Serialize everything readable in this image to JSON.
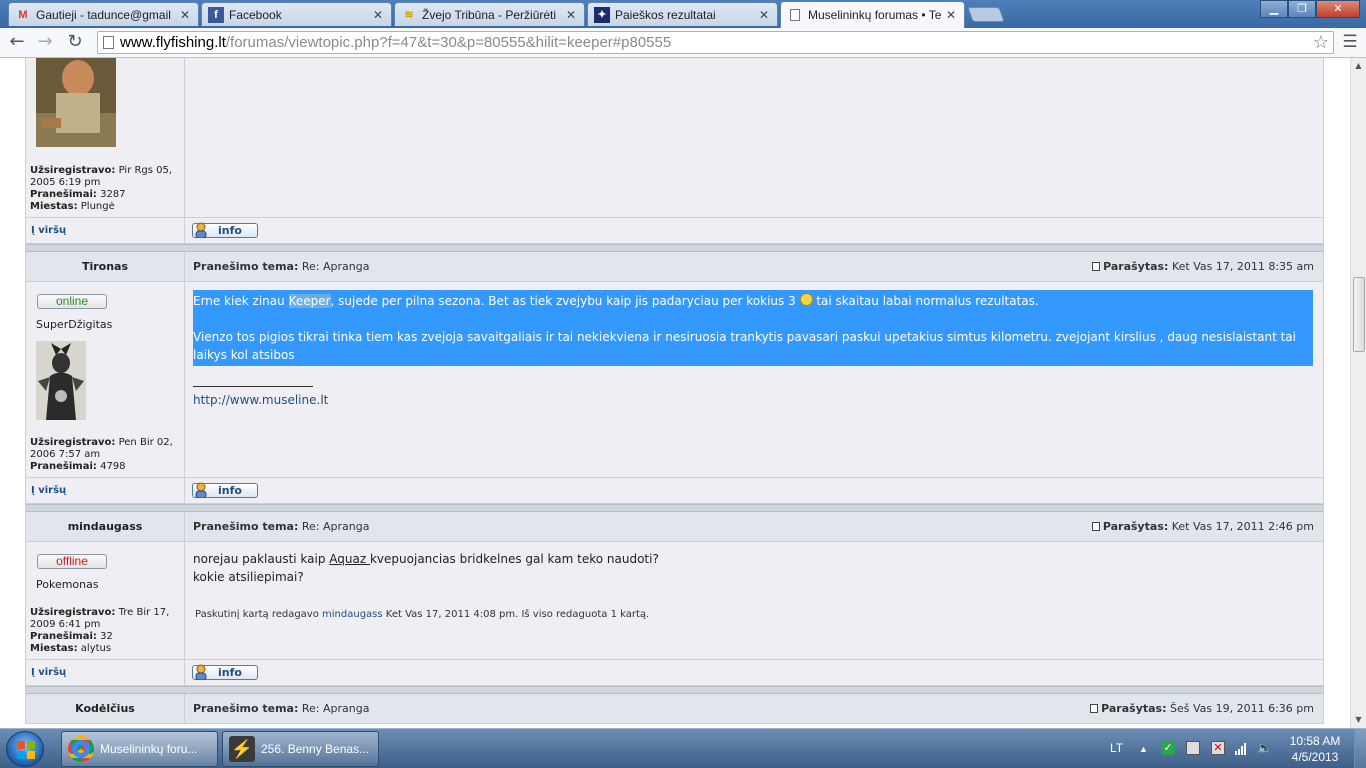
{
  "browser": {
    "tabs": [
      {
        "title": "Gautieji - tadunce@gmail",
        "icon": "gmail-icon"
      },
      {
        "title": "Facebook",
        "icon": "facebook-icon"
      },
      {
        "title": "Žvejo Tribūna - Peržiūrėti",
        "icon": "zvejo-icon"
      },
      {
        "title": "Paieškos rezultatai",
        "icon": "search-results-icon"
      },
      {
        "title": "Muselininkų forumas • Te",
        "icon": "page-icon",
        "active": true
      }
    ],
    "url_host": "www.flyfishing.lt",
    "url_path": "/forumas/viewtopic.php?f=47&t=30&p=80555&hilit=keeper#p80555"
  },
  "forum": {
    "top_label": "Į viršų",
    "info_label": "info",
    "subject_label": "Pranešimo tema:",
    "posted_label": "Parašytas:",
    "reg_label": "Užsiregistravo:",
    "posts_label": "Pranešimai:",
    "city_label": "Miestas:",
    "prev_post": {
      "registered": "Pir Rgs 05, 2005 6:19 pm",
      "posts": "3287",
      "city": "Plungė"
    },
    "post1": {
      "author": "Tironas",
      "subject": "Re: Apranga",
      "date": "Ket Vas 17, 2011 8:35 am",
      "status": "online",
      "rank": "SuperDžigitas",
      "registered": "Pen Bir 02, 2006 7:57 am",
      "posts": "4798",
      "line1_a": "Erne kiek zinau ",
      "keyword": "Keeper",
      "line1_b": ", sujede per pilna sezona. Bet as tiek zvejybu kaip jis padaryciau per kokius 3 ",
      "line1_c": " tai skaitau labai normalus rezultatas.",
      "line2": "Vienzo tos pigios tikrai tinka tiem kas zvejoja savaitgaliais ir tai nekiekviena ir nesiruosia trankytis pavasari paskui upetakius simtus kilometru. zvejojant kirslius , daug nesislaistant tai laikys kol atsibos",
      "signature": "http://www.museline.lt"
    },
    "post2": {
      "author": "mindaugass",
      "subject": "Re: Apranga",
      "date": "Ket Vas 17, 2011 2:46 pm",
      "status": "offline",
      "rank": "Pokemonas",
      "registered": "Tre Bir 17, 2009 6:41 pm",
      "posts": "32",
      "city": "alytus",
      "line1_a": "norejau paklausti kaip ",
      "link": "Aquaz ",
      "line1_b": "kvepuojancias bridkelnes gal kam teko naudoti?",
      "line2": "kokie atsiliepimai?",
      "edited_a": "Paskutinį kartą redagavo ",
      "edited_user": "mindaugass",
      "edited_b": " Ket Vas 17, 2011 4:08 pm. Iš viso redaguota 1 kartą."
    },
    "post3": {
      "author": "Kodėlčius",
      "subject": "Re: Apranga",
      "date": "Šeš Vas 19, 2011 6:36 pm"
    }
  },
  "taskbar": {
    "tasks": [
      {
        "title": "Muselininkų foru..."
      },
      {
        "title": "256. Benny Benas..."
      }
    ],
    "lang": "LT",
    "time": "10:58 AM",
    "date": "4/5/2013"
  }
}
